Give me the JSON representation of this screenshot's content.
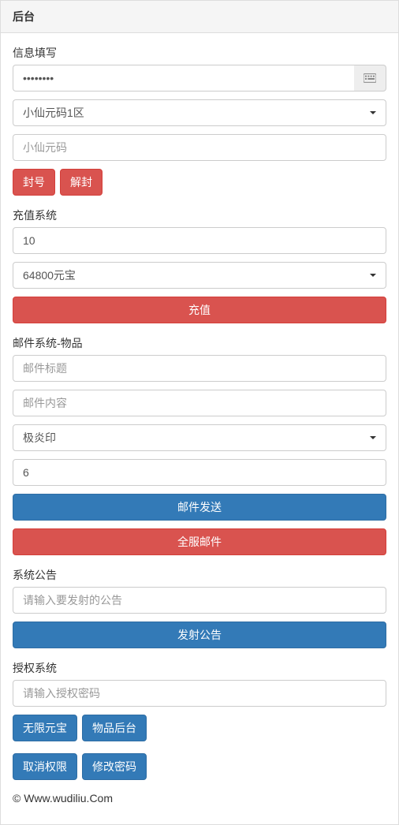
{
  "header": {
    "title": "后台"
  },
  "info": {
    "section_label": "信息填写",
    "password_placeholder": "",
    "password_value": "••••••••",
    "server_selected": "小仙元码1区",
    "account_placeholder": "小仙元码",
    "ban_label": "封号",
    "unban_label": "解封"
  },
  "recharge": {
    "section_label": "充值系统",
    "amount_value": "10",
    "option_selected": "64800元宝",
    "submit_label": "充值"
  },
  "mail": {
    "section_label": "邮件系统-物品",
    "title_placeholder": "邮件标题",
    "content_placeholder": "邮件内容",
    "item_selected": "极炎印",
    "quantity_value": "6",
    "send_label": "邮件发送",
    "broadcast_label": "全服邮件"
  },
  "announce": {
    "section_label": "系统公告",
    "placeholder": "请输入要发射的公告",
    "submit_label": "发射公告"
  },
  "auth": {
    "section_label": "授权系统",
    "placeholder": "请输入授权密码",
    "unlimited_label": "无限元宝",
    "item_backend_label": "物品后台",
    "revoke_label": "取消权限",
    "change_pw_label": "修改密码"
  },
  "footer": {
    "text": "© Www.wudiliu.Com"
  }
}
